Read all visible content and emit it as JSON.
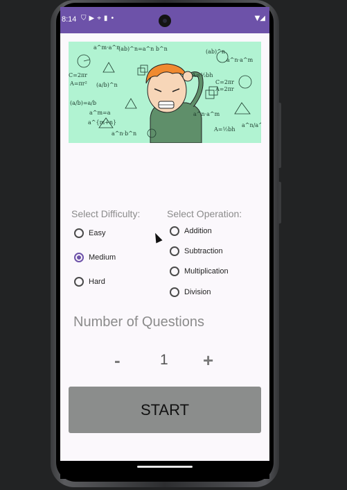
{
  "status_bar": {
    "time": "8:14",
    "notif_icons": [
      "shield-icon",
      "play-icon",
      "location-icon",
      "card-icon",
      "dot-icon"
    ],
    "system_icons": [
      "wifi-icon",
      "signal-icon"
    ]
  },
  "hero_image": {
    "description_icon": "confused-student-math-illustration"
  },
  "difficulty": {
    "label": "Select Difficulty:",
    "options": [
      {
        "label": "Easy",
        "checked": false
      },
      {
        "label": "Medium",
        "checked": true
      },
      {
        "label": "Hard",
        "checked": false
      }
    ]
  },
  "operation": {
    "label": "Select Operation:",
    "options": [
      {
        "label": "Addition",
        "checked": false
      },
      {
        "label": "Subtraction",
        "checked": false
      },
      {
        "label": "Multiplication",
        "checked": false
      },
      {
        "label": "Division",
        "checked": false
      }
    ]
  },
  "questions": {
    "title": "Number of Questions",
    "minus": "-",
    "plus": "+",
    "count": "1"
  },
  "start_button": {
    "label": "START"
  },
  "colors": {
    "accent": "#6d52a9",
    "hero_bg": "#b1f3d2",
    "button_bg": "#8b8d8c"
  }
}
